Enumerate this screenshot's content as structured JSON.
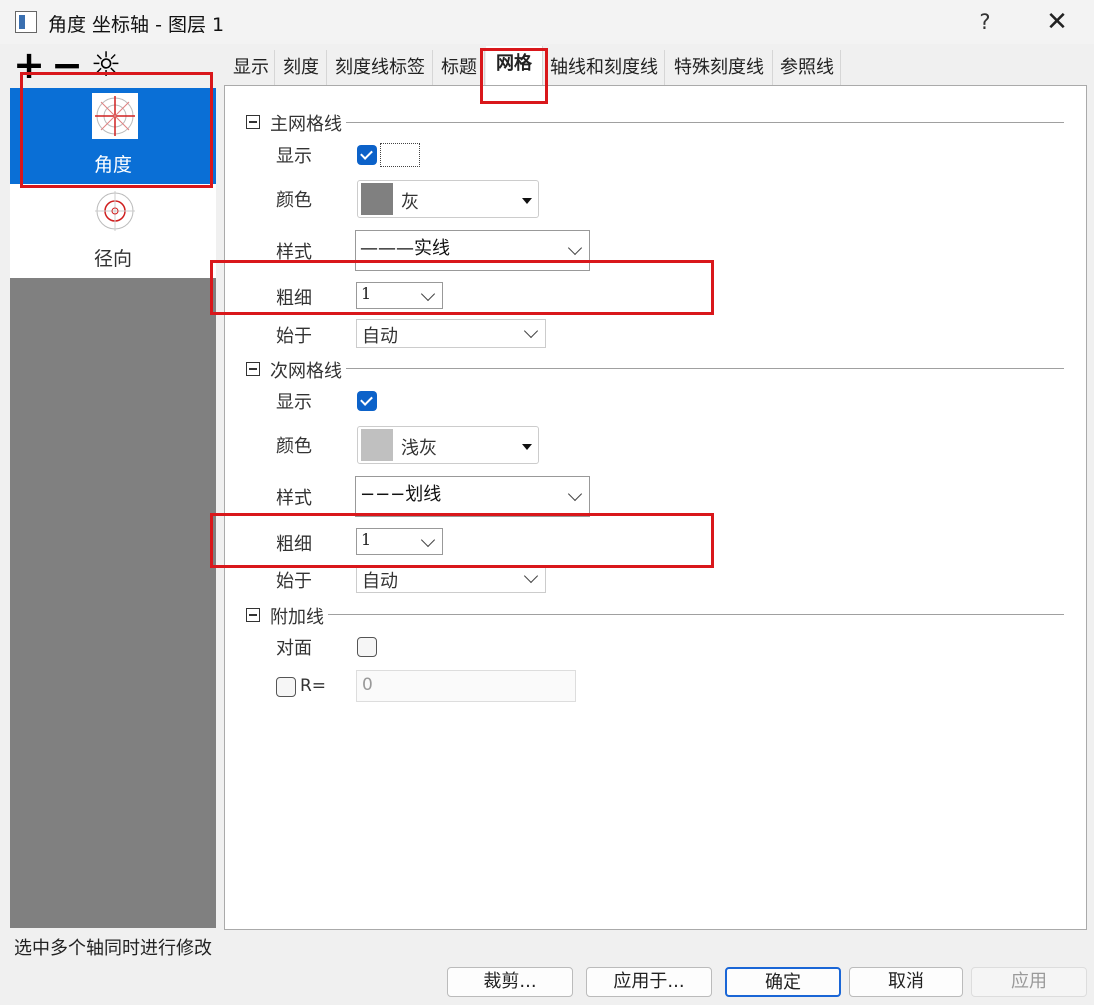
{
  "window": {
    "title": "角度 坐标轴 - 图层 1",
    "help": "?",
    "close": "✕"
  },
  "toolbar": {
    "add": "+",
    "remove": "−",
    "settings": "☼"
  },
  "axis_list": [
    {
      "label": "角度",
      "selected": true,
      "icon": "angular-axis-icon"
    },
    {
      "label": "径向",
      "selected": false,
      "icon": "radial-axis-icon"
    }
  ],
  "tabs": [
    "显示",
    "刻度",
    "刻度线标签",
    "标题",
    "网格",
    "轴线和刻度线",
    "特殊刻度线",
    "参照线"
  ],
  "active_tab": "网格",
  "major": {
    "title": "主网格线",
    "show_label": "显示",
    "show": true,
    "color_label": "颜色",
    "color": "灰",
    "color_hex": "#808080",
    "style_label": "样式",
    "style": "———实线",
    "width_label": "粗细",
    "width": "1",
    "start_label": "始于",
    "start": "自动"
  },
  "minor": {
    "title": "次网格线",
    "show_label": "显示",
    "show": true,
    "color_label": "颜色",
    "color": "浅灰",
    "color_hex": "#c0c0c0",
    "style_label": "样式",
    "style": "−−−划线",
    "width_label": "粗细",
    "width": "1",
    "start_label": "始于",
    "start": "自动"
  },
  "extra": {
    "title": "附加线",
    "opposite_label": "对面",
    "opposite": false,
    "r_label": "R=",
    "r_checked": false,
    "r_value": "0"
  },
  "status_hint": "选中多个轴同时进行修改",
  "buttons": {
    "crop": "裁剪...",
    "apply_to": "应用于...",
    "ok": "确定",
    "cancel": "取消",
    "apply": "应用"
  }
}
